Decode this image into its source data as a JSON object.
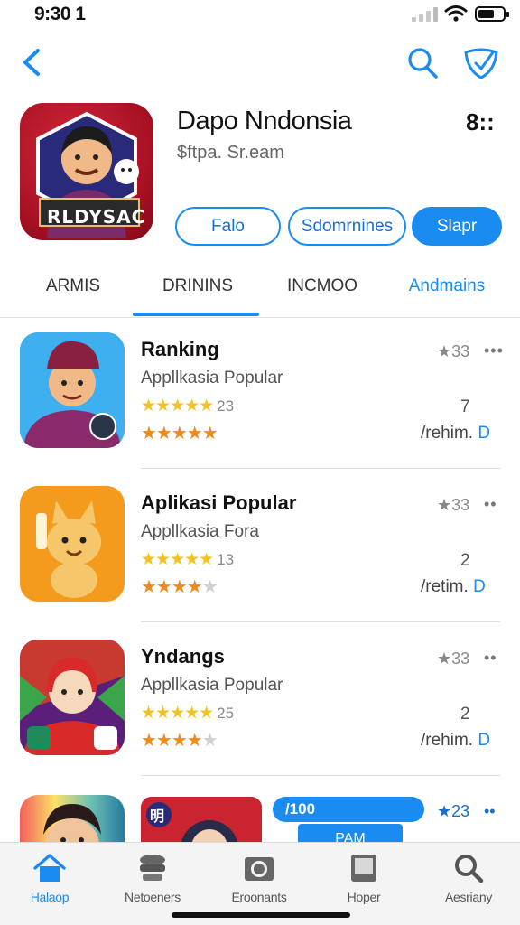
{
  "status_bar": {
    "time": "9:30 1"
  },
  "colors": {
    "accent": "#1a8bf0",
    "star_gold": "#f4c21c",
    "star_orange": "#ef8a1c",
    "hero_bg": "#a30f22"
  },
  "nav": {
    "back_icon": "chevron-left-icon",
    "search_icon": "search-icon",
    "share_icon": "share-icon"
  },
  "header": {
    "title": "Dapo Nndonsia",
    "badge": "8::",
    "subtitle": "$ftpa. Sr.eam",
    "icon_text": "RLDYSAC",
    "buttons": [
      {
        "label": "Falo"
      },
      {
        "label": "Sdomrnines"
      },
      {
        "label": "Slapr"
      }
    ]
  },
  "tabs": [
    {
      "label": "ARMIS"
    },
    {
      "label": "DRININS"
    },
    {
      "label": "INCMOO"
    },
    {
      "label": "Andmains"
    }
  ],
  "rows": [
    {
      "title": "Ranking",
      "subtitle": "Appllkasia Popular",
      "stars_top": "★★★★★",
      "count": "23",
      "stars_bottom_filled": "★★★★★",
      "stars_bottom_empty": "",
      "rating": "★33",
      "more": "•••",
      "number": "7",
      "action_prefix": "/rehim.",
      "action_suffix": "D"
    },
    {
      "title": "Aplikasi Popular",
      "subtitle": "Appllkasia Fora",
      "stars_top": "★★★★★",
      "count": "13",
      "stars_bottom_filled": "★★★★",
      "stars_bottom_empty": "★",
      "rating": "★33",
      "more": "••",
      "number": "2",
      "action_prefix": "/retim.",
      "action_suffix": "D"
    },
    {
      "title": "Yndangs",
      "subtitle": "Appllkasia Popular",
      "stars_top": "★★★★★",
      "count": "25",
      "stars_bottom_filled": "★★★★",
      "stars_bottom_empty": "★",
      "rating": "★33",
      "more": "••",
      "number": "2",
      "action_prefix": "/rehim.",
      "action_suffix": "D"
    }
  ],
  "partial_row": {
    "pill": "/100",
    "sub": "PAM",
    "rating": "★23",
    "more": "••",
    "thumb_text": "明"
  },
  "tabbar": [
    {
      "label": "Halaop",
      "icon": "home-icon"
    },
    {
      "label": "Netoeners",
      "icon": "stack-icon"
    },
    {
      "label": "Eroonants",
      "icon": "camera-icon"
    },
    {
      "label": "Hoper",
      "icon": "tablet-icon"
    },
    {
      "label": "Aesriany",
      "icon": "search-icon"
    }
  ]
}
